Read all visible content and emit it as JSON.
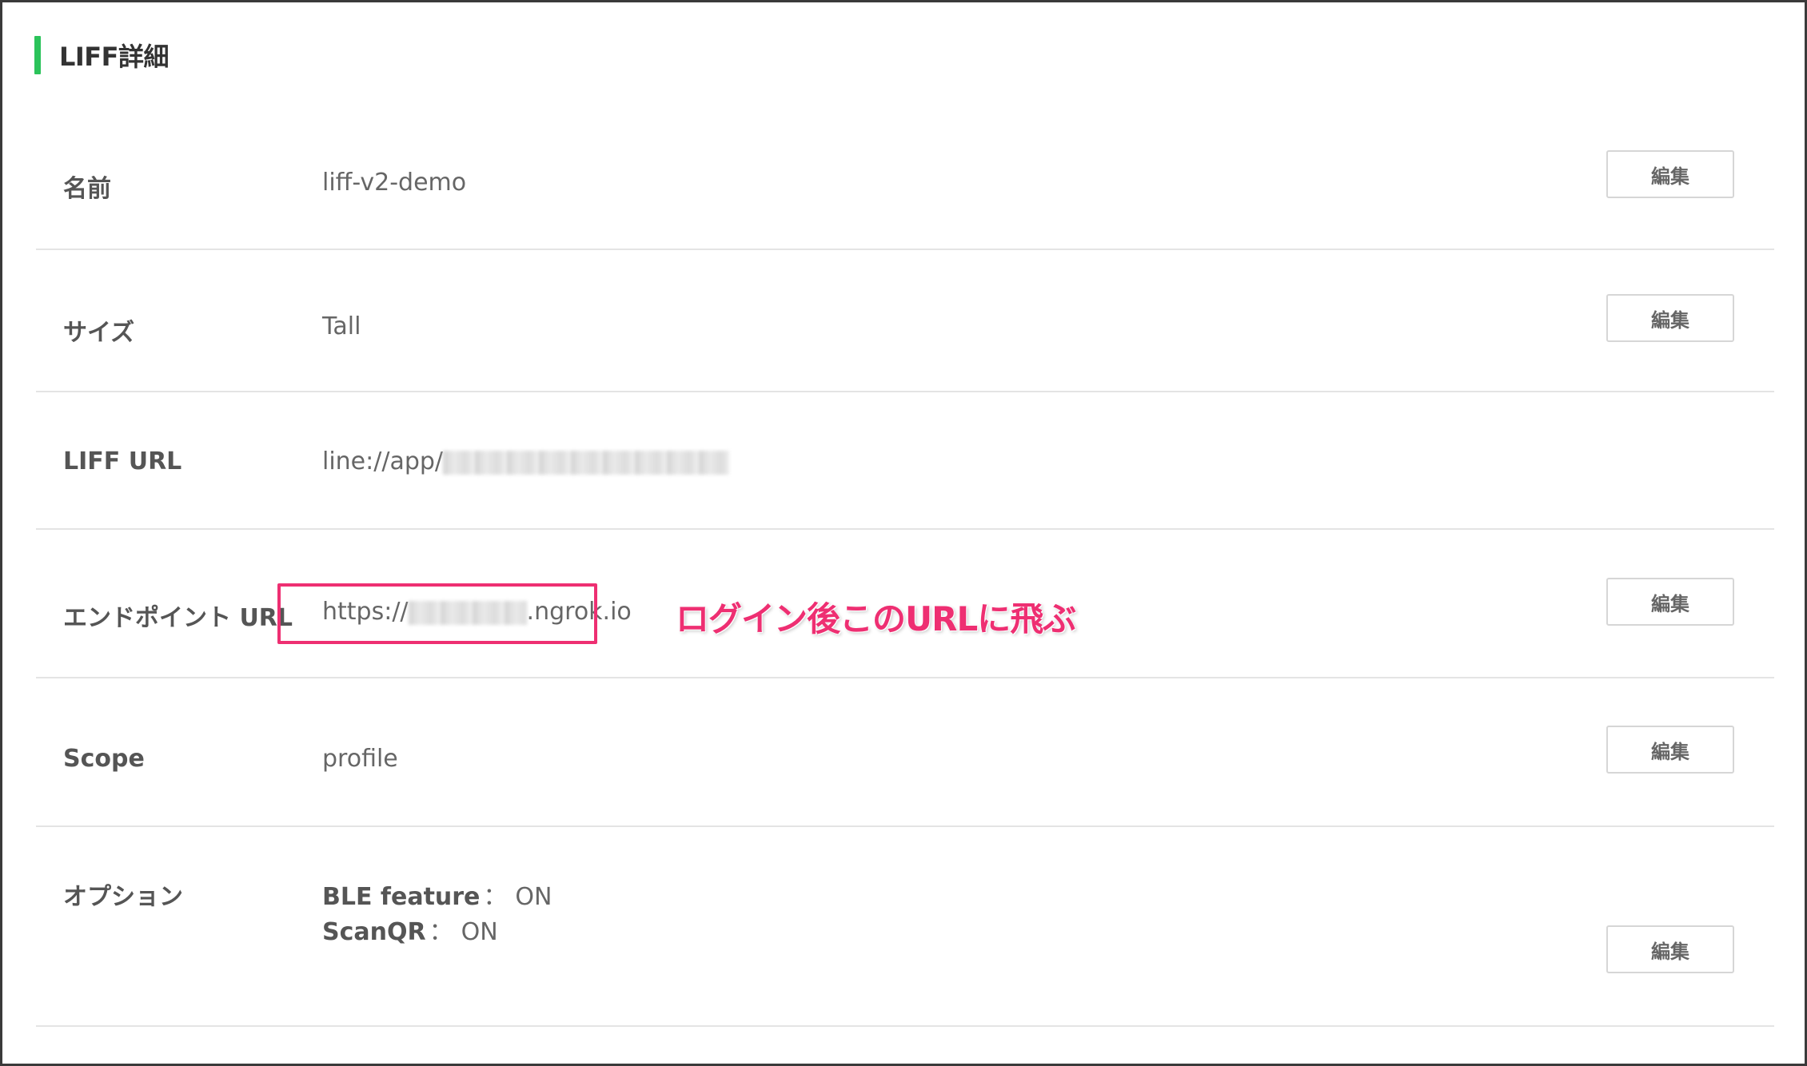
{
  "section": {
    "title": "LIFF詳細"
  },
  "rows": [
    {
      "label": "名前",
      "value": "liff-v2-demo",
      "edit_label": "編集"
    },
    {
      "label": "サイズ",
      "value": "Tall",
      "edit_label": "編集"
    },
    {
      "label": "LIFF URL",
      "value_prefix": "line://app/"
    },
    {
      "label": "エンドポイント URL",
      "value_prefix": "https://",
      "value_suffix": ".ngrok.io",
      "edit_label": "編集"
    },
    {
      "label": "Scope",
      "value": "profile",
      "edit_label": "編集"
    },
    {
      "label": "オプション",
      "options": [
        {
          "key": "BLE feature",
          "sep": "：",
          "value": "ON"
        },
        {
          "key": "ScanQR",
          "sep": "：",
          "value": "ON"
        }
      ],
      "edit_label": "編集"
    }
  ],
  "annotation": {
    "text": "ログイン後このURLに飛ぶ",
    "color": "#ee2f72"
  },
  "colors": {
    "accent_bar": "#2bc35a",
    "highlight": "#ee2f72"
  }
}
